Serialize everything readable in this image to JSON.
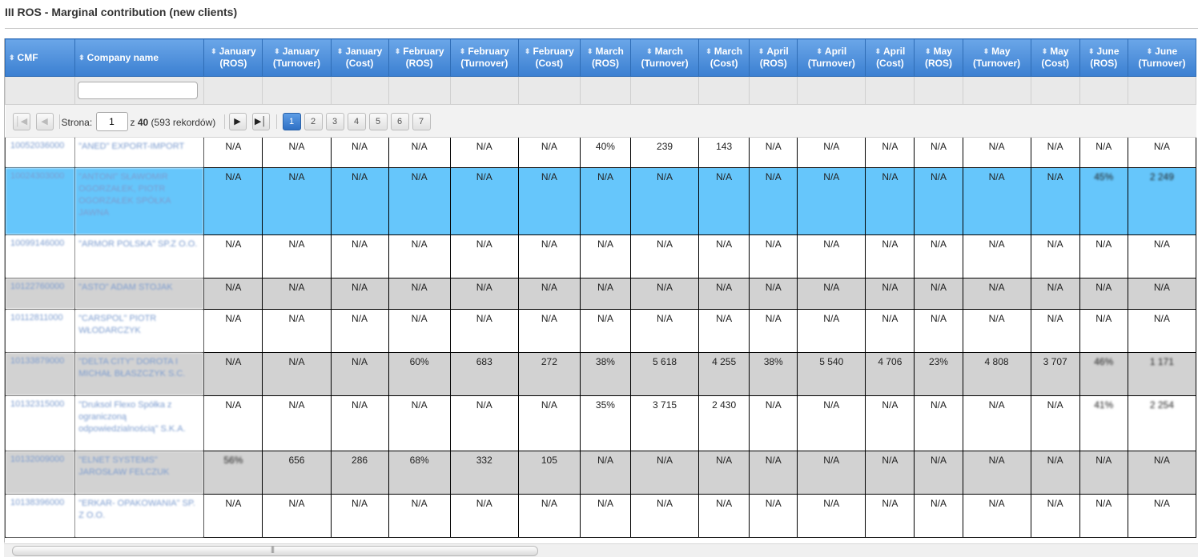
{
  "page": {
    "title": "III ROS - Marginal contribution (new clients)"
  },
  "columns": [
    {
      "key": "cmf",
      "l1": "CMF",
      "l2": ""
    },
    {
      "key": "name",
      "l1": "Company name",
      "l2": ""
    },
    {
      "key": "jan_ros",
      "l1": "January",
      "l2": "(ROS)"
    },
    {
      "key": "jan_turn",
      "l1": "January",
      "l2": "(Turnover)"
    },
    {
      "key": "jan_cost",
      "l1": "January",
      "l2": "(Cost)"
    },
    {
      "key": "feb_ros",
      "l1": "February",
      "l2": "(ROS)"
    },
    {
      "key": "feb_turn",
      "l1": "February",
      "l2": "(Turnover)"
    },
    {
      "key": "feb_cost",
      "l1": "February",
      "l2": "(Cost)"
    },
    {
      "key": "mar_ros",
      "l1": "March",
      "l2": "(ROS)"
    },
    {
      "key": "mar_turn",
      "l1": "March",
      "l2": "(Turnover)"
    },
    {
      "key": "mar_cost",
      "l1": "March",
      "l2": "(Cost)"
    },
    {
      "key": "apr_ros",
      "l1": "April",
      "l2": "(ROS)"
    },
    {
      "key": "apr_turn",
      "l1": "April",
      "l2": "(Turnover)"
    },
    {
      "key": "apr_cost",
      "l1": "April",
      "l2": "(Cost)"
    },
    {
      "key": "may_ros",
      "l1": "May",
      "l2": "(ROS)"
    },
    {
      "key": "may_turn",
      "l1": "May",
      "l2": "(Turnover)"
    },
    {
      "key": "may_cost",
      "l1": "May",
      "l2": "(Cost)"
    },
    {
      "key": "jun_ros",
      "l1": "June",
      "l2": "(ROS)"
    },
    {
      "key": "jun_turn",
      "l1": "June",
      "l2": "(Turnover)"
    }
  ],
  "pager": {
    "page_label": "Strona:",
    "current_page": "1",
    "of_label": "z",
    "total_pages": "40",
    "records": "(593 rekordów)",
    "pages": [
      "1",
      "2",
      "3",
      "4",
      "5",
      "6",
      "7"
    ],
    "icons": {
      "first": "first-page-icon",
      "prev": "prev-page-icon",
      "next": "next-page-icon",
      "last": "last-page-icon"
    }
  },
  "rows": [
    {
      "style": "white",
      "cmf": "10052036000",
      "name": "\"ANED\" EXPORT-IMPORT",
      "values": [
        "N/A",
        "N/A",
        "N/A",
        "N/A",
        "N/A",
        "N/A",
        "40%",
        "239",
        "143",
        "N/A",
        "N/A",
        "N/A",
        "N/A",
        "N/A",
        "N/A",
        "N/A",
        "N/A"
      ],
      "blur": []
    },
    {
      "style": "blue",
      "cmf": "10024303000",
      "name": "\"ANTONI\" SŁAWOMIR OGORZAŁEK, PIOTR OGORZAŁEK SPÓŁKA JAWNA",
      "values": [
        "N/A",
        "N/A",
        "N/A",
        "N/A",
        "N/A",
        "N/A",
        "N/A",
        "N/A",
        "N/A",
        "N/A",
        "N/A",
        "N/A",
        "N/A",
        "N/A",
        "N/A",
        "45%",
        "2 249"
      ],
      "blur": [
        15,
        16
      ]
    },
    {
      "style": "white",
      "cmf": "10099146000",
      "name": "\"ARMOR POLSKA\" SP.Z O.O.",
      "values": [
        "N/A",
        "N/A",
        "N/A",
        "N/A",
        "N/A",
        "N/A",
        "N/A",
        "N/A",
        "N/A",
        "N/A",
        "N/A",
        "N/A",
        "N/A",
        "N/A",
        "N/A",
        "N/A",
        "N/A"
      ],
      "blur": []
    },
    {
      "style": "gray",
      "cmf": "10122760000",
      "name": "\"ASTO\" ADAM STOJAK",
      "values": [
        "N/A",
        "N/A",
        "N/A",
        "N/A",
        "N/A",
        "N/A",
        "N/A",
        "N/A",
        "N/A",
        "N/A",
        "N/A",
        "N/A",
        "N/A",
        "N/A",
        "N/A",
        "N/A",
        "N/A"
      ],
      "blur": []
    },
    {
      "style": "white",
      "cmf": "10112811000",
      "name": "\"CARSPOL\" PIOTR WŁODARCZYK",
      "values": [
        "N/A",
        "N/A",
        "N/A",
        "N/A",
        "N/A",
        "N/A",
        "N/A",
        "N/A",
        "N/A",
        "N/A",
        "N/A",
        "N/A",
        "N/A",
        "N/A",
        "N/A",
        "N/A",
        "N/A"
      ],
      "blur": []
    },
    {
      "style": "gray",
      "cmf": "10133879000",
      "name": "\"DELTA CITY\" DOROTA I MICHAŁ BŁASZCZYK S.C.",
      "values": [
        "N/A",
        "N/A",
        "N/A",
        "60%",
        "683",
        "272",
        "38%",
        "5 618",
        "4 255",
        "38%",
        "5 540",
        "4 706",
        "23%",
        "4 808",
        "3 707",
        "46%",
        "1 171"
      ],
      "blur": [
        15,
        16
      ]
    },
    {
      "style": "white",
      "cmf": "10132315000",
      "name": "\"Druksol Flexo Spółka z ograniczoną odpowiedzialnością\" S.K.A.",
      "values": [
        "N/A",
        "N/A",
        "N/A",
        "N/A",
        "N/A",
        "N/A",
        "35%",
        "3 715",
        "2 430",
        "N/A",
        "N/A",
        "N/A",
        "N/A",
        "N/A",
        "N/A",
        "41%",
        "2 254"
      ],
      "blur": [
        15,
        16
      ]
    },
    {
      "style": "gray",
      "cmf": "10132009000",
      "name": "\"ELNET SYSTEMS\" JAROSŁAW FELCZUK",
      "values": [
        "56%",
        "656",
        "286",
        "68%",
        "332",
        "105",
        "N/A",
        "N/A",
        "N/A",
        "N/A",
        "N/A",
        "N/A",
        "N/A",
        "N/A",
        "N/A",
        "N/A",
        "N/A"
      ],
      "blur": [
        0
      ]
    },
    {
      "style": "white",
      "cmf": "10138396000",
      "name": "\"ERKAR- OPAKOWANIA\" SP. Z O.O.",
      "values": [
        "N/A",
        "N/A",
        "N/A",
        "N/A",
        "N/A",
        "N/A",
        "N/A",
        "N/A",
        "N/A",
        "N/A",
        "N/A",
        "N/A",
        "N/A",
        "N/A",
        "N/A",
        "N/A",
        "N/A"
      ],
      "blur": []
    }
  ]
}
